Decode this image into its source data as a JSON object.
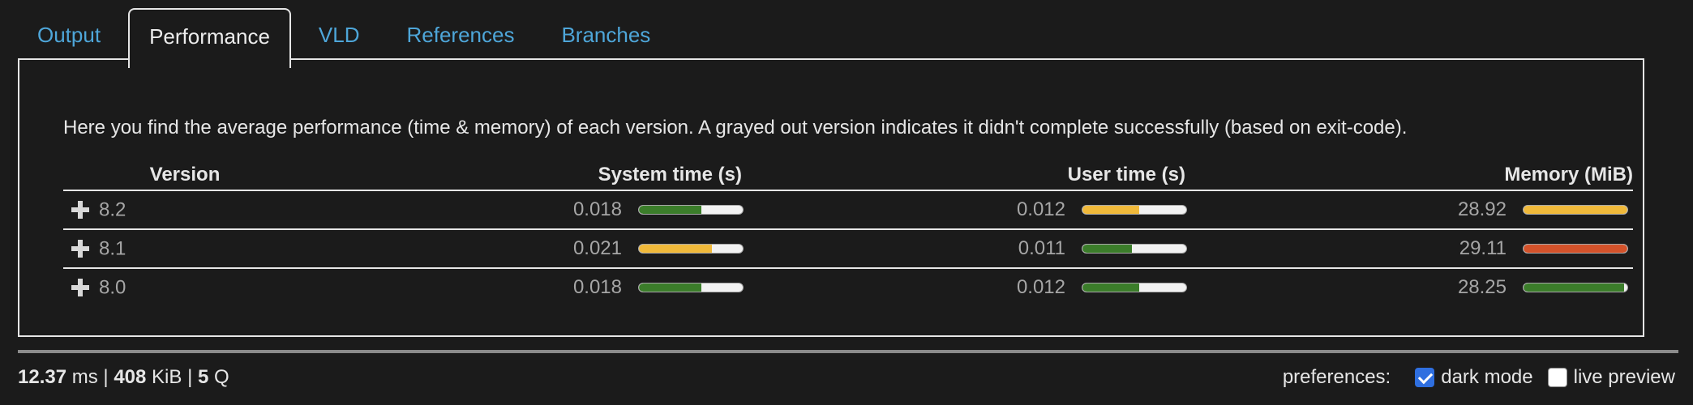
{
  "tabs": [
    {
      "label": "Output",
      "active": false
    },
    {
      "label": "Performance",
      "active": true
    },
    {
      "label": "VLD",
      "active": false
    },
    {
      "label": "References",
      "active": false
    },
    {
      "label": "Branches",
      "active": false
    }
  ],
  "description": "Here you find the average performance (time & memory) of each version. A grayed out version indicates it didn't complete successfully (based on exit-code).",
  "table": {
    "headers": {
      "version": "Version",
      "system_time": "System time (s)",
      "user_time": "User time (s)",
      "memory": "Memory (MiB)"
    },
    "rows": [
      {
        "version": "8.2",
        "system_time": {
          "value": "0.018",
          "fill": 0.6,
          "color": "#3b7d2a"
        },
        "user_time": {
          "value": "0.012",
          "fill": 0.55,
          "color": "#f0b93a"
        },
        "memory": {
          "value": "28.92",
          "fill": 1.0,
          "color": "#f0b93a"
        }
      },
      {
        "version": "8.1",
        "system_time": {
          "value": "0.021",
          "fill": 0.7,
          "color": "#f0b93a"
        },
        "user_time": {
          "value": "0.011",
          "fill": 0.48,
          "color": "#3b7d2a"
        },
        "memory": {
          "value": "29.11",
          "fill": 1.0,
          "color": "#d4522a"
        }
      },
      {
        "version": "8.0",
        "system_time": {
          "value": "0.018",
          "fill": 0.6,
          "color": "#3b7d2a"
        },
        "user_time": {
          "value": "0.012",
          "fill": 0.55,
          "color": "#3b7d2a"
        },
        "memory": {
          "value": "28.25",
          "fill": 0.97,
          "color": "#3b7d2a"
        }
      }
    ]
  },
  "footer": {
    "ms_value": "12.37",
    "ms_unit": "ms",
    "sep1": "|",
    "kib_value": "408",
    "kib_unit": "KiB",
    "sep2": "|",
    "q_value": "5",
    "q_unit": "Q"
  },
  "preferences": {
    "label": "preferences:",
    "dark_mode": {
      "label": "dark mode",
      "checked": true
    },
    "live_preview": {
      "label": "live preview",
      "checked": false
    }
  },
  "colors": {
    "background": "#1b1b1b",
    "link": "#4ea6d9",
    "green": "#3b7d2a",
    "yellow": "#f0b93a",
    "red": "#d4522a"
  }
}
